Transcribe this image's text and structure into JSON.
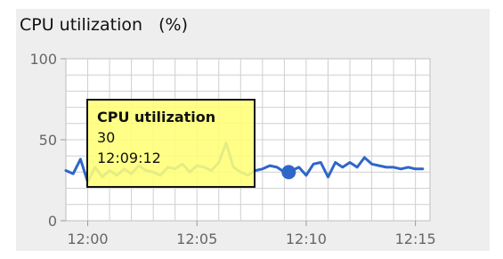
{
  "chart_data": {
    "type": "line",
    "title": "CPU utilization   (%)",
    "xlabel": "",
    "ylabel": "",
    "ylim": [
      0,
      100
    ],
    "yticks": [
      "0",
      "50",
      "100"
    ],
    "xticks": [
      "12:00",
      "12:05",
      "12:10",
      "12:15"
    ],
    "grid": true,
    "series": [
      {
        "color": "#2f66c9",
        "x": [
          "11:59:00",
          "11:59:20",
          "11:59:40",
          "12:00:00",
          "12:00:20",
          "12:00:40",
          "12:01:00",
          "12:01:20",
          "12:01:40",
          "12:02:00",
          "12:02:20",
          "12:02:40",
          "12:03:00",
          "12:03:20",
          "12:03:40",
          "12:04:00",
          "12:04:20",
          "12:04:40",
          "12:05:00",
          "12:05:20",
          "12:05:40",
          "12:06:00",
          "12:06:20",
          "12:06:40",
          "12:07:00",
          "12:07:20",
          "12:07:40",
          "12:08:00",
          "12:08:20",
          "12:08:40",
          "12:09:00",
          "12:09:12",
          "12:09:40",
          "12:10:00",
          "12:10:20",
          "12:10:40",
          "12:11:00",
          "12:11:20",
          "12:11:40",
          "12:12:00",
          "12:12:20",
          "12:12:40",
          "12:13:00",
          "12:13:20",
          "12:13:40",
          "12:14:00",
          "12:14:20",
          "12:14:40",
          "12:15:00",
          "12:15:20"
        ],
        "values": [
          31,
          29,
          38,
          24,
          33,
          27,
          31,
          28,
          32,
          29,
          34,
          31,
          30,
          28,
          33,
          32,
          35,
          30,
          34,
          33,
          31,
          36,
          48,
          33,
          30,
          28,
          31,
          32,
          34,
          33,
          30,
          30,
          33,
          28,
          35,
          36,
          27,
          36,
          33,
          36,
          33,
          39,
          35,
          34,
          33,
          33,
          32,
          33,
          32,
          32
        ]
      }
    ],
    "highlight": {
      "x": "12:09:12",
      "value": 30
    }
  },
  "tooltip": {
    "title": "CPU utilization",
    "value": "30",
    "time": "12:09:12"
  }
}
